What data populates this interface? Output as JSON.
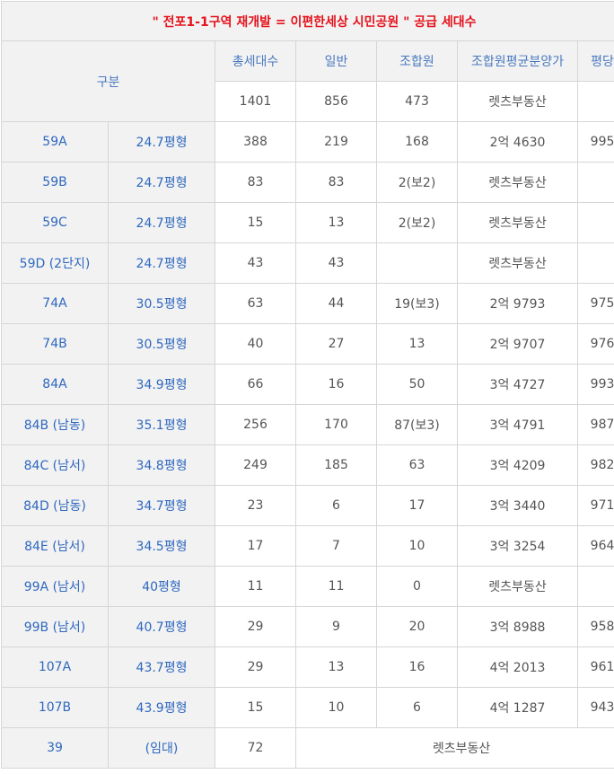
{
  "title": "\" 전포1-1구역 재개발 = 이편한세상 시민공원 \" 공급 세대수",
  "header": {
    "group_label": "구분",
    "columns": [
      "총세대수",
      "일반",
      "조합원",
      "조합원평균분양가",
      "평당"
    ]
  },
  "totals": {
    "total": "1401",
    "general": "856",
    "union": "473",
    "avg_price": "렛츠부동산",
    "per_pyeong": ""
  },
  "rows": [
    {
      "type": "59A",
      "size": "24.7평형",
      "total": "388",
      "general": "219",
      "union": "168",
      "avg_price": "2억 4630",
      "per_pyeong": "995"
    },
    {
      "type": "59B",
      "size": "24.7평형",
      "total": "83",
      "general": "83",
      "union": "2(보2)",
      "avg_price": "렛츠부동산",
      "per_pyeong": ""
    },
    {
      "type": "59C",
      "size": "24.7평형",
      "total": "15",
      "general": "13",
      "union": "2(보2)",
      "avg_price": "렛츠부동산",
      "per_pyeong": ""
    },
    {
      "type": "59D (2단지)",
      "size": "24.7평형",
      "total": "43",
      "general": "43",
      "union": "",
      "avg_price": "렛츠부동산",
      "per_pyeong": ""
    },
    {
      "type": "74A",
      "size": "30.5평형",
      "total": "63",
      "general": "44",
      "union": "19(보3)",
      "avg_price": "2억 9793",
      "per_pyeong": "975"
    },
    {
      "type": "74B",
      "size": "30.5평형",
      "total": "40",
      "general": "27",
      "union": "13",
      "avg_price": "2억 9707",
      "per_pyeong": "976"
    },
    {
      "type": "84A",
      "size": "34.9평형",
      "total": "66",
      "general": "16",
      "union": "50",
      "avg_price": "3억 4727",
      "per_pyeong": "993"
    },
    {
      "type": "84B (남동)",
      "size": "35.1평형",
      "total": "256",
      "general": "170",
      "union": "87(보3)",
      "avg_price": "3억 4791",
      "per_pyeong": "987"
    },
    {
      "type": "84C (남서)",
      "size": "34.8평형",
      "total": "249",
      "general": "185",
      "union": "63",
      "avg_price": "3억 4209",
      "per_pyeong": "982"
    },
    {
      "type": "84D (남동)",
      "size": "34.7평형",
      "total": "23",
      "general": "6",
      "union": "17",
      "avg_price": "3억 3440",
      "per_pyeong": "971"
    },
    {
      "type": "84E (남서)",
      "size": "34.5평형",
      "total": "17",
      "general": "7",
      "union": "10",
      "avg_price": "3억 3254",
      "per_pyeong": "964"
    },
    {
      "type": "99A (남서)",
      "size": "40평형",
      "total": "11",
      "general": "11",
      "union": "0",
      "avg_price": "렛츠부동산",
      "per_pyeong": ""
    },
    {
      "type": "99B (남서)",
      "size": "40.7평형",
      "total": "29",
      "general": "9",
      "union": "20",
      "avg_price": "3억 8988",
      "per_pyeong": "958"
    },
    {
      "type": "107A",
      "size": "43.7평형",
      "total": "29",
      "general": "13",
      "union": "16",
      "avg_price": "4억 2013",
      "per_pyeong": "961"
    },
    {
      "type": "107B",
      "size": "43.9평형",
      "total": "15",
      "general": "10",
      "union": "6",
      "avg_price": "4억 1287",
      "per_pyeong": "943"
    }
  ],
  "rental": {
    "type": "39",
    "size": "(임대)",
    "total": "72",
    "note": "렛츠부동산"
  },
  "colors": {
    "title": "#e5121c",
    "label": "#2f68bf",
    "header_bg": "#f2f2f2",
    "border": "#d6d6d6",
    "text": "#555555"
  }
}
